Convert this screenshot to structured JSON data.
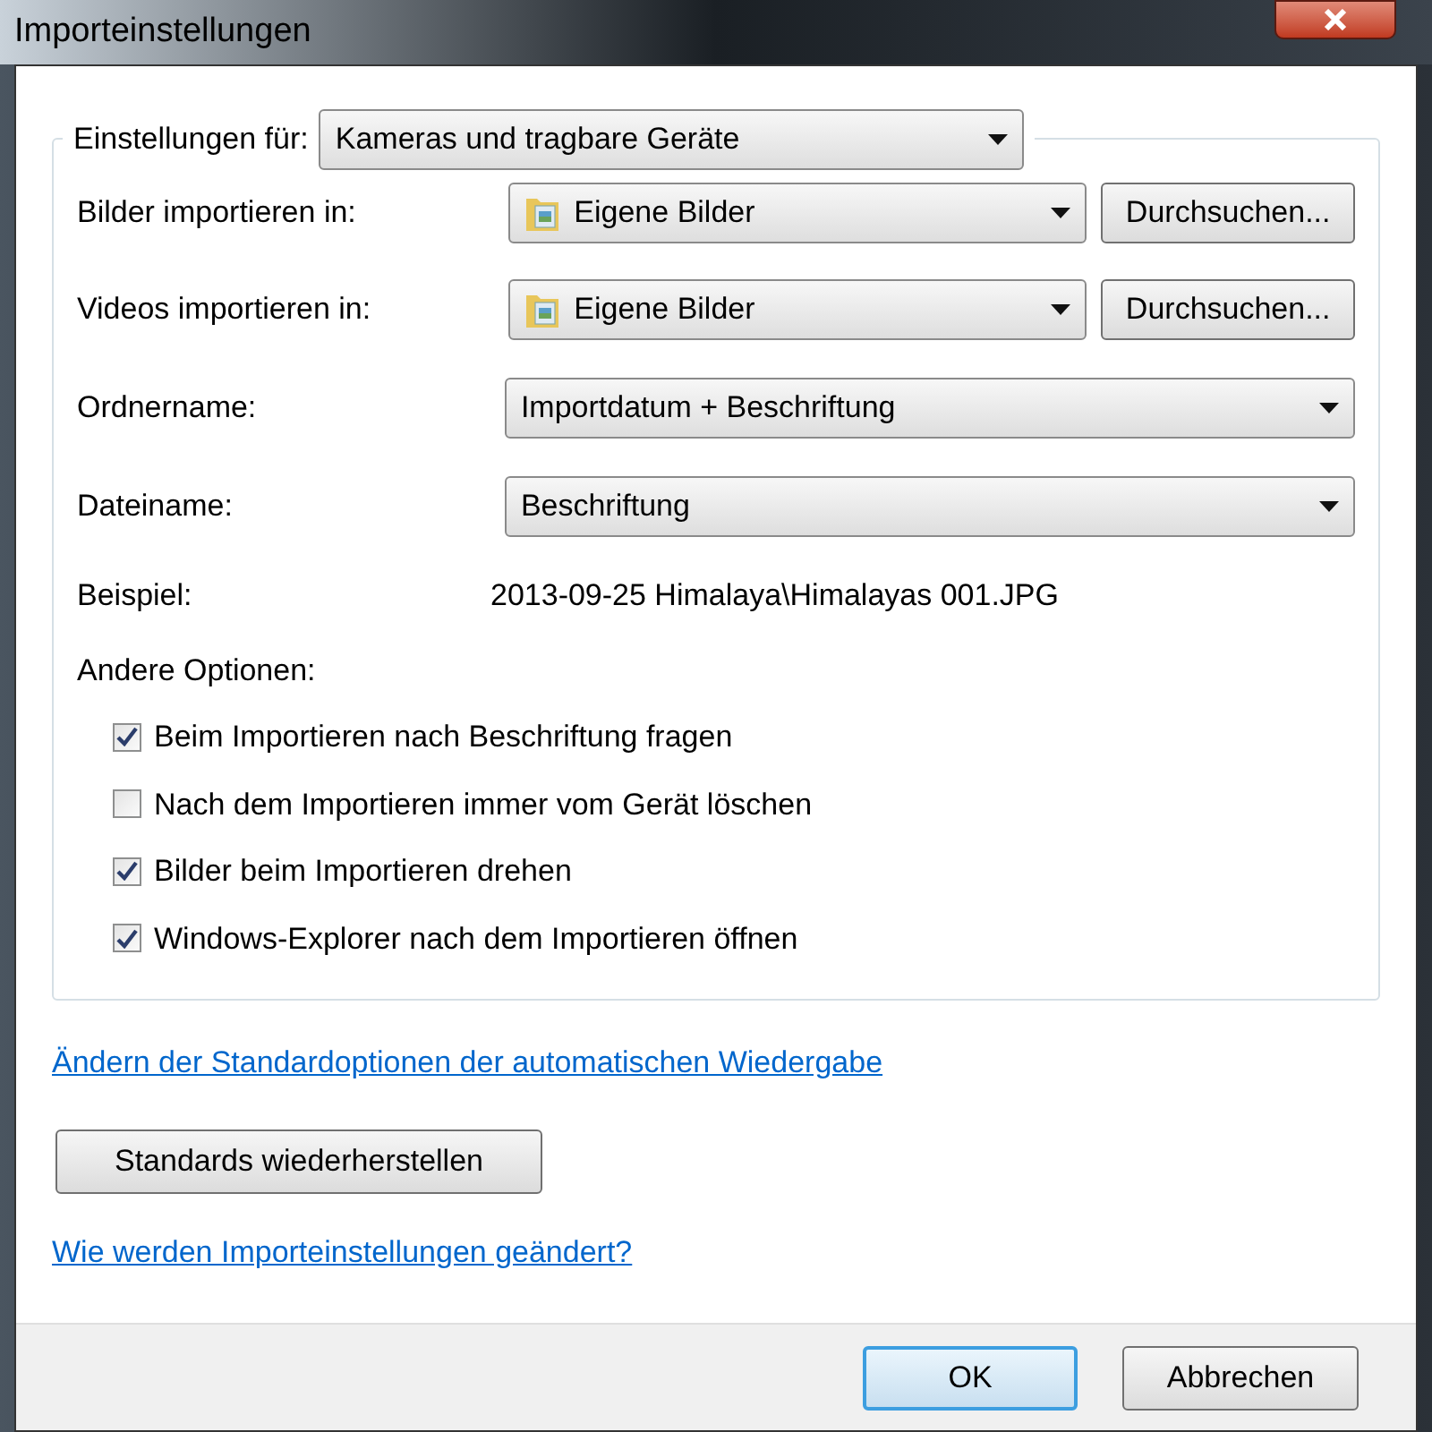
{
  "window": {
    "title": "Importeinstellungen"
  },
  "settings_for": {
    "label": "Einstellungen für:",
    "value": "Kameras und tragbare Geräte"
  },
  "folder_rows": [
    {
      "label": "Bilder importieren in:",
      "value": "Eigene Bilder",
      "button": "Durchsuchen..."
    },
    {
      "label": "Videos importieren in:",
      "value": "Eigene Bilder",
      "button": "Durchsuchen..."
    }
  ],
  "name_rows": [
    {
      "label": "Ordnername:",
      "value": "Importdatum + Beschriftung"
    },
    {
      "label": "Dateiname:",
      "value": "Beschriftung"
    }
  ],
  "example": {
    "label": "Beispiel:",
    "value": "2013-09-25 Himalaya\\Himalayas 001.JPG"
  },
  "other_options": {
    "label": "Andere Optionen:",
    "options": [
      {
        "label": "Beim Importieren nach Beschriftung fragen",
        "checked": true
      },
      {
        "label": "Nach dem Importieren immer vom Gerät löschen",
        "checked": false
      },
      {
        "label": "Bilder beim Importieren drehen",
        "checked": true
      },
      {
        "label": "Windows-Explorer nach dem Importieren öffnen",
        "checked": true
      }
    ]
  },
  "autoplay_link": "Ändern der Standardoptionen der automatischen Wiedergabe",
  "restore_button": "Standards wiederherstellen",
  "help_link": "Wie werden Importeinstellungen geändert?",
  "buttons": [
    {
      "label": "OK",
      "default": true
    },
    {
      "label": "Abbrechen",
      "default": false
    }
  ]
}
